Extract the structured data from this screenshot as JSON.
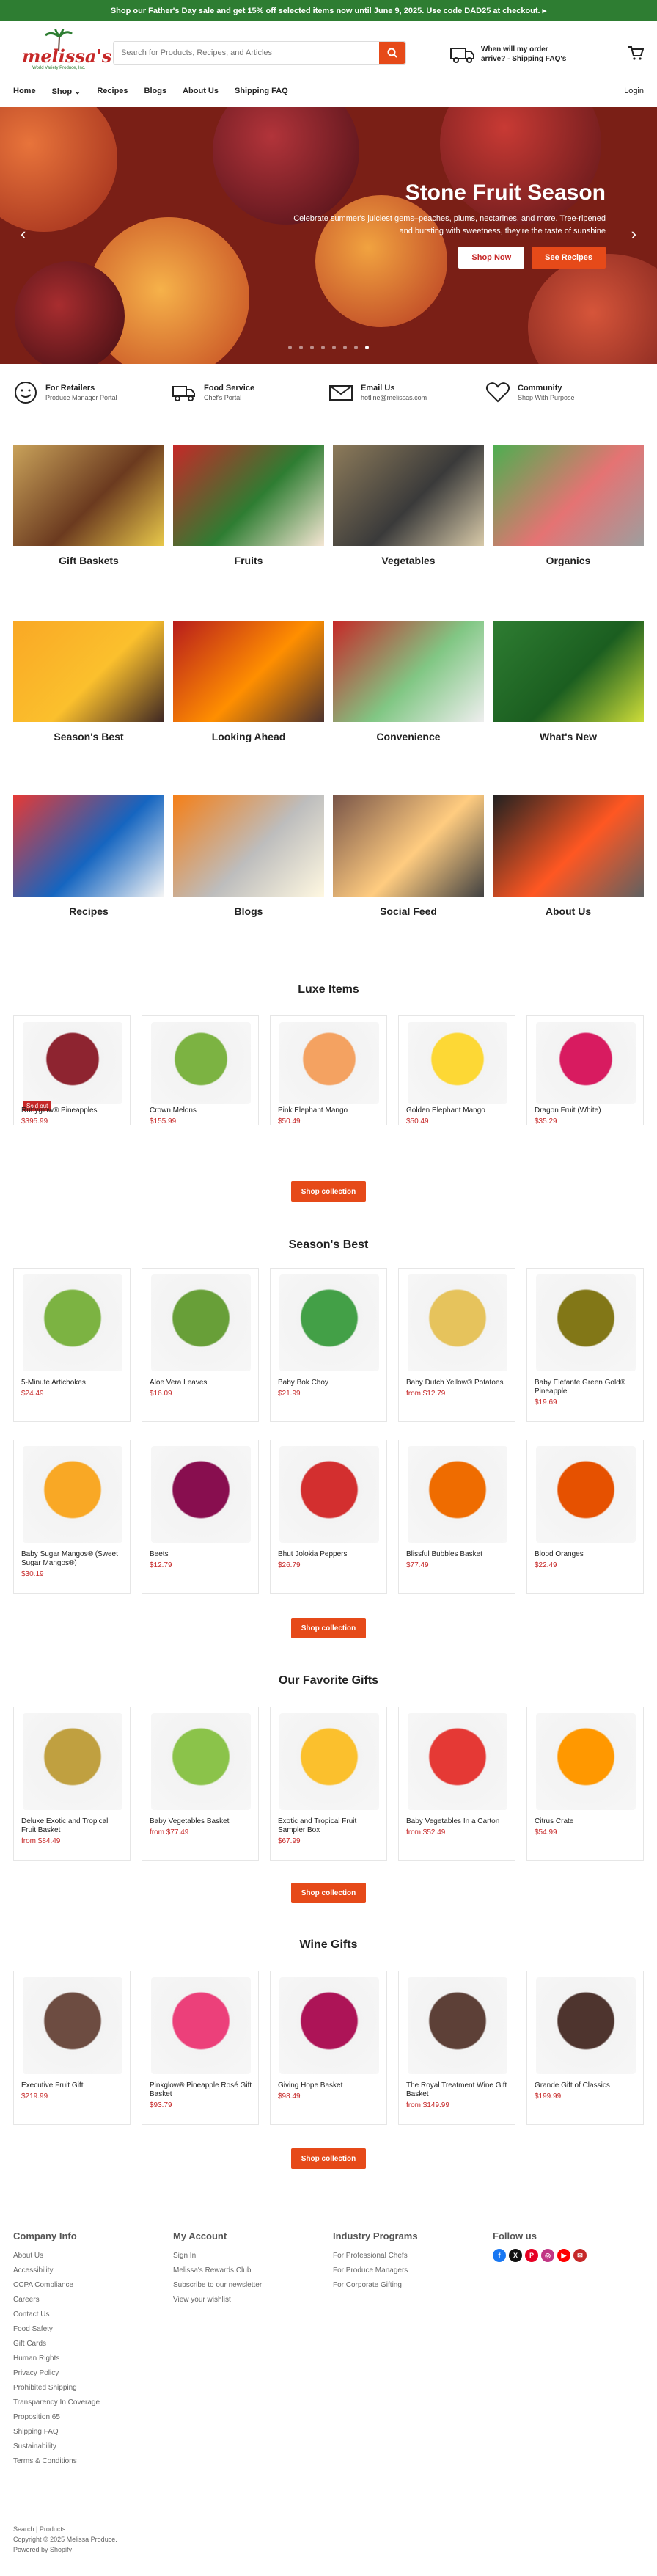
{
  "announcement": "Shop our Father's Day sale and get 15% off selected items now until June 9, 2025. Use code DAD25 at checkout. ▸",
  "logo": {
    "word": "melissa's",
    "tag": "World Variety Produce, Inc."
  },
  "search": {
    "placeholder": "Search for Products, Recipes, and Articles"
  },
  "delivery": {
    "line1": "When will my order",
    "line2": "arrive? - Shipping FAQ's"
  },
  "nav": {
    "items": [
      "Home",
      "Shop",
      "Recipes",
      "Blogs",
      "About Us",
      "Shipping FAQ"
    ],
    "shop_caret": "⌄",
    "login": "Login"
  },
  "hero": {
    "title": "Stone Fruit Season",
    "text": "Celebrate summer's juiciest gems–peaches, plums, nectarines, and more. Tree-ripened and bursting with sweetness, they're the taste of sunshine",
    "btn1": "Shop Now",
    "btn2": "See Recipes",
    "prev": "‹",
    "next": "›"
  },
  "features": [
    {
      "title": "For Retailers",
      "sub": "Produce Manager Portal",
      "icon": "smiley-icon"
    },
    {
      "title": "Food Service",
      "sub": "Chef's Portal",
      "icon": "truck-icon"
    },
    {
      "title": "Email Us",
      "sub": "hotline@melissas.com",
      "icon": "envelope-icon"
    },
    {
      "title": "Community",
      "sub": "Shop With Purpose",
      "icon": "heart-icon"
    }
  ],
  "categories": [
    {
      "label": "Gift Baskets",
      "colors": [
        "#c9a25a",
        "#6b3a1f",
        "#e8c84a"
      ]
    },
    {
      "label": "Fruits",
      "colors": [
        "#c62828",
        "#2e7d32",
        "#f5e6d3"
      ]
    },
    {
      "label": "Vegetables",
      "colors": [
        "#8d7b5a",
        "#3a3a3a",
        "#d7c9a8"
      ]
    },
    {
      "label": "Organics",
      "colors": [
        "#4caf50",
        "#e57373",
        "#9e9e9e"
      ]
    },
    {
      "label": "Season's Best",
      "colors": [
        "#f9a825",
        "#fbc02d",
        "#3e2723"
      ]
    },
    {
      "label": "Looking Ahead",
      "colors": [
        "#b71c1c",
        "#ff8f00",
        "#4e342e"
      ]
    },
    {
      "label": "Convenience",
      "colors": [
        "#c62828",
        "#81c784",
        "#eeeeee"
      ]
    },
    {
      "label": "What's New",
      "colors": [
        "#2e7d32",
        "#1b5e20",
        "#cddc39"
      ]
    },
    {
      "label": "Recipes",
      "colors": [
        "#e53935",
        "#1565c0",
        "#f5f5f5"
      ]
    },
    {
      "label": "Blogs",
      "colors": [
        "#f57f17",
        "#bdbdbd",
        "#fff8e1"
      ]
    },
    {
      "label": "Social Feed",
      "colors": [
        "#795548",
        "#ffcc80",
        "#424242"
      ]
    },
    {
      "label": "About Us",
      "colors": [
        "#212121",
        "#ff5722",
        "#616161"
      ]
    }
  ],
  "luxe": {
    "title": "Luxe Items",
    "items": [
      {
        "name": "Rubyglow® Pineapples",
        "price": "$395.99",
        "badge": "Sold out",
        "color": "#8e2430"
      },
      {
        "name": "Crown Melons",
        "price": "$155.99",
        "color": "#7cb342"
      },
      {
        "name": "Pink Elephant Mango",
        "price": "$50.49",
        "color": "#f4a261"
      },
      {
        "name": "Golden Elephant Mango",
        "price": "$50.49",
        "color": "#fdd835"
      },
      {
        "name": "Dragon Fruit (White)",
        "price": "$35.29",
        "color": "#d81b60"
      }
    ],
    "button": "Shop collection"
  },
  "season": {
    "title": "Season's Best",
    "items": [
      {
        "name": "5-Minute Artichokes",
        "price": "$24.49",
        "color": "#7cb342"
      },
      {
        "name": "Aloe Vera Leaves",
        "price": "$16.09",
        "color": "#689f38"
      },
      {
        "name": "Baby Bok Choy",
        "price": "$21.99",
        "color": "#43a047"
      },
      {
        "name": "Baby Dutch Yellow® Potatoes",
        "price": "from $12.79",
        "color": "#e6c35c"
      },
      {
        "name": "Baby Elefante Green Gold® Pineapple",
        "price": "$19.69",
        "color": "#827717"
      },
      {
        "name": "Baby Sugar Mangos® (Sweet Sugar Mangos®)",
        "price": "$30.19",
        "color": "#f9a825"
      },
      {
        "name": "Beets",
        "price": "$12.79",
        "color": "#880e4f"
      },
      {
        "name": "Bhut Jolokia Peppers",
        "price": "$26.79",
        "color": "#d32f2f"
      },
      {
        "name": "Blissful Bubbles Basket",
        "price": "$77.49",
        "color": "#ef6c00"
      },
      {
        "name": "Blood Oranges",
        "price": "$22.49",
        "color": "#e65100"
      }
    ],
    "button": "Shop collection"
  },
  "gifts": {
    "title": "Our Favorite Gifts",
    "items": [
      {
        "name": "Deluxe Exotic and Tropical Fruit Basket",
        "price": "from $84.49",
        "color": "#c0a040"
      },
      {
        "name": "Baby Vegetables Basket",
        "price": "from $77.49",
        "color": "#8bc34a"
      },
      {
        "name": "Exotic and Tropical Fruit Sampler Box",
        "price": "$67.99",
        "color": "#fbc02d"
      },
      {
        "name": "Baby Vegetables In a Carton",
        "price": "from $52.49",
        "color": "#e53935"
      },
      {
        "name": "Citrus Crate",
        "price": "$54.99",
        "color": "#ff9800"
      }
    ],
    "button": "Shop collection"
  },
  "wine": {
    "title": "Wine Gifts",
    "items": [
      {
        "name": "Executive Fruit Gift",
        "price": "$219.99",
        "color": "#6d4c41"
      },
      {
        "name": "Pinkglow® Pineapple Rosé Gift Basket",
        "price": "$93.79",
        "color": "#ec407a"
      },
      {
        "name": "Giving Hope Basket",
        "price": "$98.49",
        "color": "#ad1457"
      },
      {
        "name": "The Royal Treatment Wine Gift Basket",
        "price": "from $149.99",
        "color": "#5d4037"
      },
      {
        "name": "Grande Gift of Classics",
        "price": "$199.99",
        "color": "#4e342e"
      }
    ],
    "button": "Shop collection"
  },
  "footer": {
    "company": {
      "title": "Company Info",
      "links": [
        "About Us",
        "Accessibility",
        "CCPA Compliance",
        "Careers",
        "Contact Us",
        "Food Safety",
        "Gift Cards",
        "Human Rights",
        "Privacy Policy",
        "Prohibited Shipping",
        "Transparency In Coverage",
        "Proposition 65",
        "Shipping FAQ",
        "Sustainability",
        "Terms & Conditions"
      ]
    },
    "account": {
      "title": "My Account",
      "links": [
        "Sign In",
        "Melissa's Rewards Club",
        "Subscribe to our newsletter",
        "View your wishlist"
      ]
    },
    "industry": {
      "title": "Industry Programs",
      "links": [
        "For Professional Chefs",
        "For Produce Managers",
        "For Corporate Gifting"
      ]
    },
    "follow": {
      "title": "Follow us",
      "icons": [
        {
          "name": "facebook-icon",
          "glyph": "f",
          "color": "#1877f2"
        },
        {
          "name": "x-icon",
          "glyph": "X",
          "color": "#111111"
        },
        {
          "name": "pinterest-icon",
          "glyph": "P",
          "color": "#e60023"
        },
        {
          "name": "instagram-icon",
          "glyph": "◎",
          "color": "#c13584"
        },
        {
          "name": "youtube-icon",
          "glyph": "▶",
          "color": "#ff0000"
        },
        {
          "name": "email-icon",
          "glyph": "✉",
          "color": "#c62828"
        }
      ]
    },
    "legal": {
      "search": "Search",
      "sep": "|",
      "products": "Products",
      "copy": "Copyright © 2025 Melissa Produce.",
      "powered": "Powered by Shopify"
    }
  },
  "colors": {
    "brand": "#e64a19",
    "announce": "#2e7d32",
    "price": "#c62828"
  }
}
